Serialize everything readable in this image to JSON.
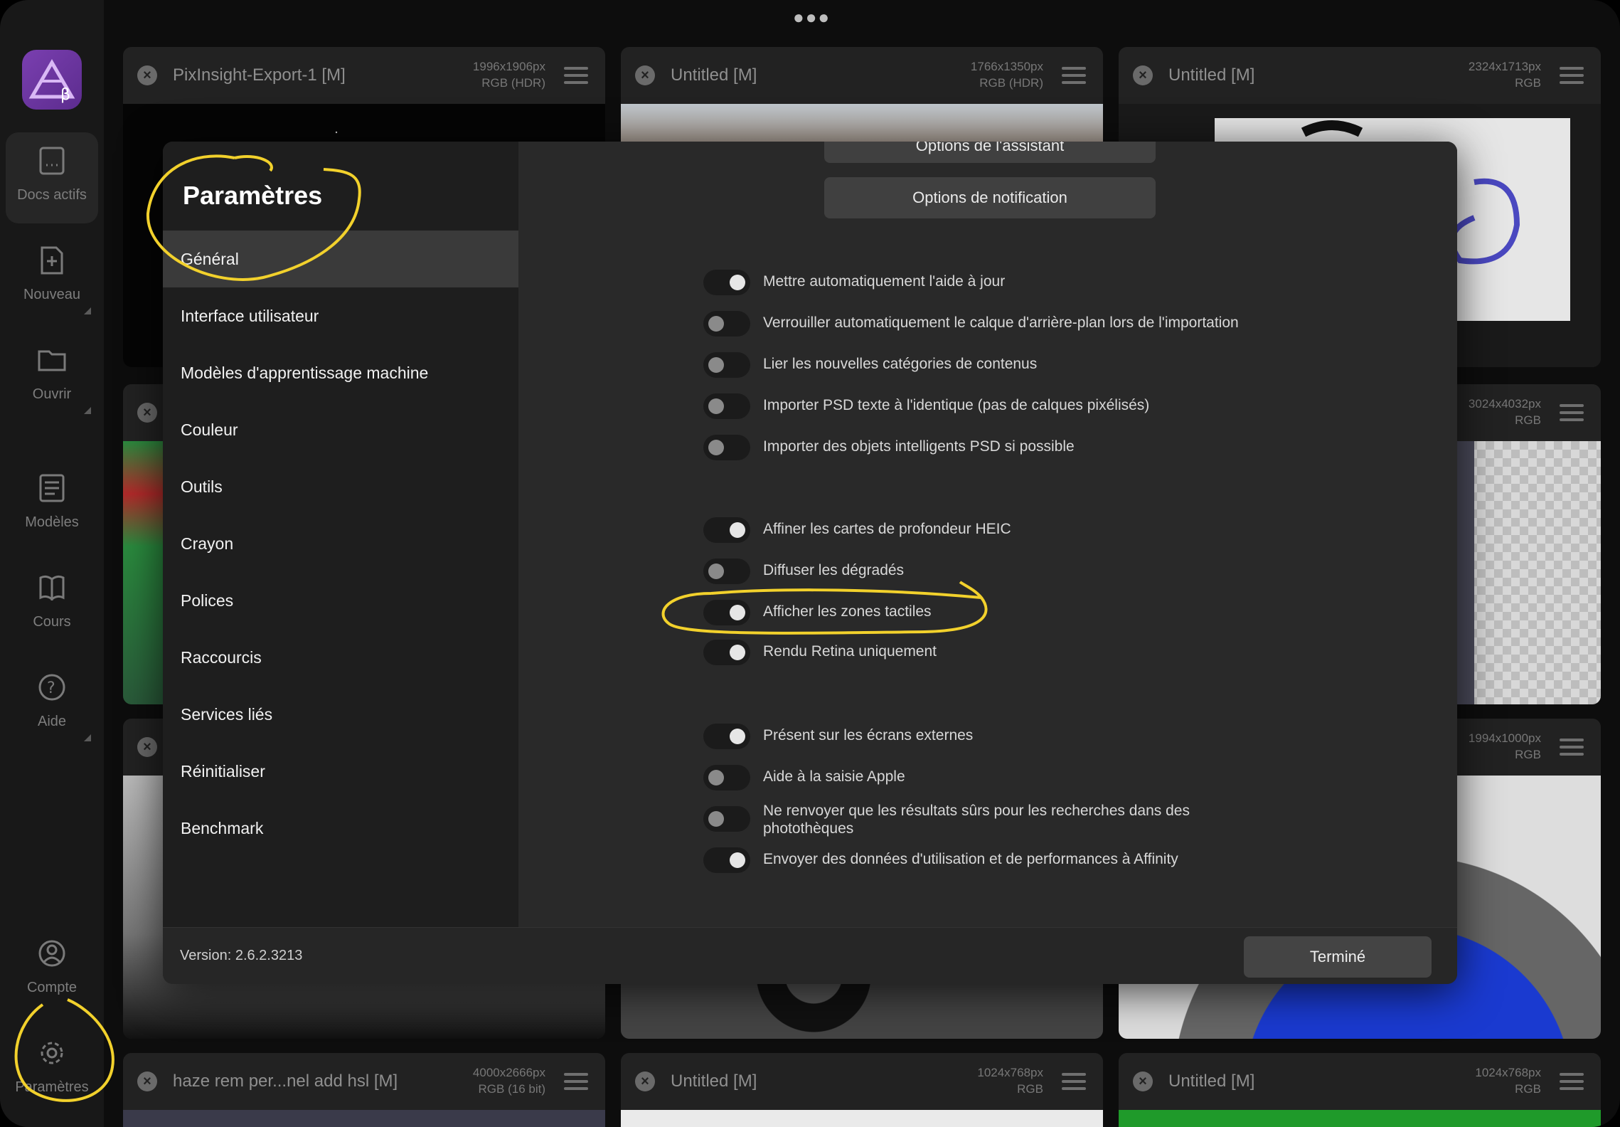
{
  "rail": {
    "items": [
      {
        "label": "Docs actifs"
      },
      {
        "label": "Nouveau"
      },
      {
        "label": "Ouvrir"
      },
      {
        "label": "Modèles"
      },
      {
        "label": "Cours"
      },
      {
        "label": "Aide"
      },
      {
        "label": "Compte"
      },
      {
        "label": "Paramètres"
      }
    ]
  },
  "documents": [
    {
      "title": "PixInsight-Export-1 [M]",
      "size": "1996x1906px",
      "format": "RGB (HDR)"
    },
    {
      "title": "Untitled [M]",
      "size": "1766x1350px",
      "format": "RGB (HDR)"
    },
    {
      "title": "Untitled [M]",
      "size": "2324x1713px",
      "format": "RGB"
    },
    {
      "size": "3024x4032px",
      "format": "RGB"
    },
    {
      "size": "1994x1000px",
      "format": "RGB"
    },
    {
      "title": "haze rem per...nel add hsl [M]",
      "size": "4000x2666px",
      "format": "RGB (16 bit)"
    },
    {
      "title": "Untitled [M]",
      "size": "1024x768px",
      "format": "RGB"
    },
    {
      "title": "Untitled [M]",
      "size": "1024x768px",
      "format": "RGB"
    }
  ],
  "settings": {
    "title": "Paramètres",
    "categories": [
      "Général",
      "Interface utilisateur",
      "Modèles d'apprentissage machine",
      "Couleur",
      "Outils",
      "Crayon",
      "Polices",
      "Raccourcis",
      "Services liés",
      "Réinitialiser",
      "Benchmark"
    ],
    "selected_category": "Général",
    "buttons": {
      "assistant": "Options de l'assistant",
      "notification": "Options de notification"
    },
    "options": [
      {
        "label": "Mettre automatiquement l'aide à jour",
        "on": true
      },
      {
        "label": "Verrouiller automatiquement le calque d'arrière-plan lors de l'importation",
        "on": false
      },
      {
        "label": "Lier les nouvelles catégories de contenus",
        "on": false
      },
      {
        "label": "Importer PSD texte à l'identique (pas de calques pixélisés)",
        "on": false
      },
      {
        "label": "Importer des objets intelligents PSD si possible",
        "on": false
      },
      {
        "label": "Affiner les cartes de profondeur HEIC",
        "on": true
      },
      {
        "label": "Diffuser les dégradés",
        "on": false
      },
      {
        "label": "Afficher les zones tactiles",
        "on": true
      },
      {
        "label": "Rendu Retina uniquement",
        "on": true
      },
      {
        "label": "Présent sur les écrans externes",
        "on": true
      },
      {
        "label": "Aide à la saisie Apple",
        "on": false
      },
      {
        "label": "Ne renvoyer que les résultats sûrs pour les recherches dans des photothèques",
        "on": false
      },
      {
        "label": "Envoyer des données d'utilisation et de performances à Affinity",
        "on": true
      }
    ],
    "version": "Version: 2.6.2.3213",
    "done_label": "Terminé"
  },
  "colors": {
    "annotation": "#f2d12c",
    "app_accent": "#7a3fb0"
  },
  "icons": [
    "ellipsis-icon",
    "docs-icon",
    "new-doc-icon",
    "folder-icon",
    "templates-icon",
    "book-icon",
    "help-icon",
    "account-icon",
    "gear-icon",
    "close-icon",
    "hamburger-icon"
  ]
}
